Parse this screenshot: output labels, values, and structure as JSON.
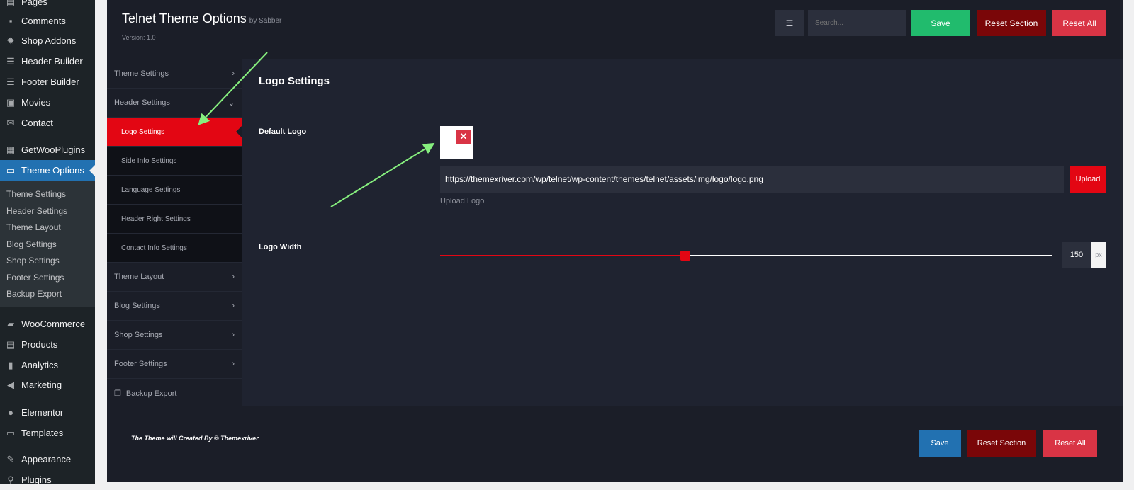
{
  "wp_menu": {
    "items": [
      {
        "label": "Pages",
        "icon": "pages-icon"
      },
      {
        "label": "Comments",
        "icon": "comments-icon"
      },
      {
        "label": "Shop Addons",
        "icon": "shop-addons-icon"
      },
      {
        "label": "Header Builder",
        "icon": "header-builder-icon"
      },
      {
        "label": "Footer Builder",
        "icon": "footer-builder-icon"
      },
      {
        "label": "Movies",
        "icon": "movies-icon"
      },
      {
        "label": "Contact",
        "icon": "mail-icon"
      },
      {
        "label": "GetWooPlugins",
        "icon": "getwooplugins-icon"
      },
      {
        "label": "Theme Options",
        "icon": "folder-icon"
      },
      {
        "label": "WooCommerce",
        "icon": "woo-icon"
      },
      {
        "label": "Products",
        "icon": "products-icon"
      },
      {
        "label": "Analytics",
        "icon": "analytics-icon"
      },
      {
        "label": "Marketing",
        "icon": "marketing-icon"
      },
      {
        "label": "Elementor",
        "icon": "elementor-icon"
      },
      {
        "label": "Templates",
        "icon": "templates-icon"
      },
      {
        "label": "Appearance",
        "icon": "appearance-icon"
      },
      {
        "label": "Plugins",
        "icon": "plugins-icon"
      }
    ],
    "submenu": [
      "Theme Settings",
      "Header Settings",
      "Theme Layout",
      "Blog Settings",
      "Shop Settings",
      "Footer Settings",
      "Backup Export"
    ]
  },
  "header": {
    "title": "Telnet Theme Options",
    "by": "by Sabber",
    "version": "Version: 1.0",
    "search_placeholder": "Search...",
    "save": "Save",
    "reset_section": "Reset Section",
    "reset_all": "Reset All"
  },
  "nav": {
    "theme_settings": "Theme Settings",
    "header_settings": "Header Settings",
    "sub": [
      "Logo Settings",
      "Side Info Settings",
      "Language Settings",
      "Header Right Settings",
      "Contact Info Settings"
    ],
    "theme_layout": "Theme Layout",
    "blog_settings": "Blog Settings",
    "shop_settings": "Shop Settings",
    "footer_settings": "Footer Settings",
    "backup_export": "Backup Export"
  },
  "content": {
    "section_title": "Logo Settings",
    "default_logo_label": "Default Logo",
    "logo_url": "https://themexriver.com/wp/telnet/wp-content/themes/telnet/assets/img/logo/logo.png",
    "upload": "Upload",
    "upload_desc": "Upload Logo",
    "logo_width_label": "Logo Width",
    "logo_width_value": "150",
    "logo_width_unit": "px",
    "logo_width_slider_fraction": 0.4
  },
  "footer": {
    "credit": "The Theme will Created By © Themexriver",
    "save": "Save",
    "reset_section": "Reset Section",
    "reset_all": "Reset All"
  },
  "colors": {
    "accent_red": "#e30613",
    "save_green": "#21bb6d",
    "wp_blue": "#2271b1",
    "arrow_green": "#86ef7e"
  }
}
